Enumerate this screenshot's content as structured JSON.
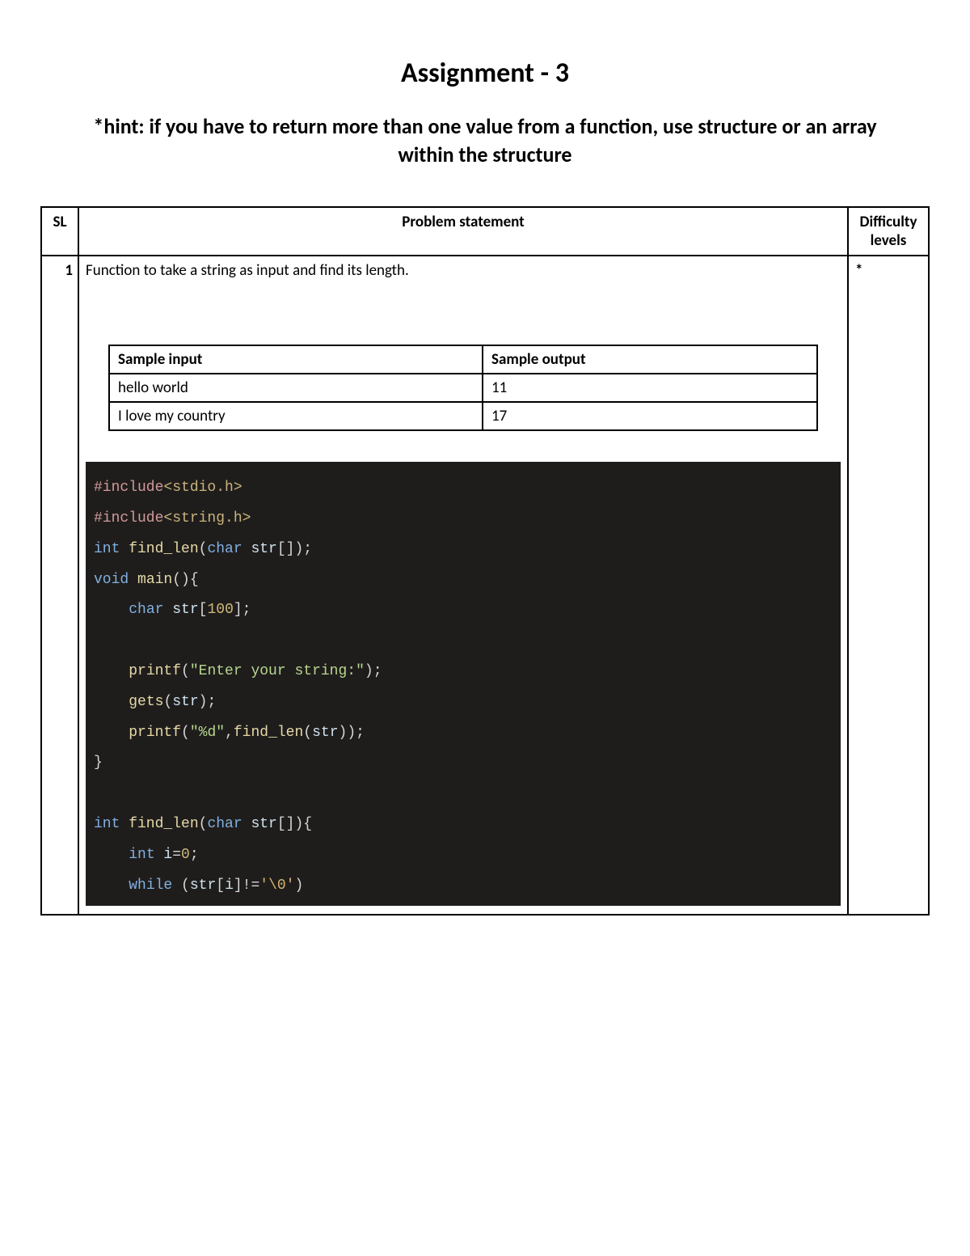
{
  "title": "Assignment - 3",
  "hint": "*hint: if you have to return more than one value from a function, use structure or an array within the structure",
  "headers": {
    "sl": "SL",
    "problem": "Problem statement",
    "difficulty": "Difficulty levels"
  },
  "row": {
    "sl": "1",
    "problem_text": "Function to take a string as input and find its length.",
    "difficulty": "*",
    "sample_headers": {
      "input": "Sample input",
      "output": "Sample output"
    },
    "samples": [
      {
        "input": "hello world",
        "output": "11"
      },
      {
        "input": "I love my country",
        "output": "17"
      }
    ],
    "code": {
      "l1_pre": "#include",
      "l1_inc": "<stdio.h>",
      "l2_pre": "#include",
      "l2_inc": "<string.h>",
      "l3_kw1": "int",
      "l3_fn": " find_len",
      "l3_p1": "(",
      "l3_kw2": "char",
      "l3_id": " str",
      "l3_p2": "[]);",
      "l4_kw": "void",
      "l4_fn": " main",
      "l4_p": "(){",
      "l5_ind": "    ",
      "l5_kw": "char",
      "l5_id": " str",
      "l5_p1": "[",
      "l5_num": "100",
      "l5_p2": "];",
      "l6_ind": "    ",
      "l6_fn": "printf",
      "l6_p1": "(",
      "l6_str": "\"Enter your string:\"",
      "l6_p2": ");",
      "l7_ind": "    ",
      "l7_fn": "gets",
      "l7_p1": "(",
      "l7_id": "str",
      "l7_p2": ");",
      "l8_ind": "    ",
      "l8_fn": "printf",
      "l8_p1": "(",
      "l8_str": "\"%d\"",
      "l8_p2": ",",
      "l8_fn2": "find_len",
      "l8_p3": "(",
      "l8_id": "str",
      "l8_p4": "));",
      "l9": "}",
      "l10_kw1": "int",
      "l10_fn": " find_len",
      "l10_p1": "(",
      "l10_kw2": "char",
      "l10_id": " str",
      "l10_p2": "[]){",
      "l11_ind": "    ",
      "l11_kw": "int",
      "l11_id": " i",
      "l11_eq": "=",
      "l11_num": "0",
      "l11_p": ";",
      "l12_ind": "    ",
      "l12_kw": "while",
      "l12_p1": " (",
      "l12_id": "str",
      "l12_p2": "[",
      "l12_id2": "i",
      "l12_p3": "]!=",
      "l12_esc": "'\\0'",
      "l12_p4": ")"
    }
  }
}
